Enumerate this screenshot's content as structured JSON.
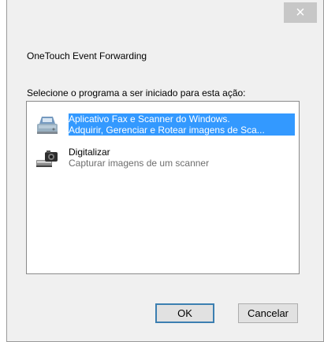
{
  "window": {
    "close_glyph": "×",
    "heading": "OneTouch Event Forwarding",
    "instruction": "Selecione o programa a ser iniciado para esta ação:"
  },
  "programs": [
    {
      "name": "Aplicativo Fax e Scanner do Windows.",
      "description": "Adquirir, Gerenciar e Rotear imagens de Sca...",
      "icon": "fax-scanner-icon",
      "selected": true
    },
    {
      "name": "Digitalizar",
      "description": "Capturar imagens de um scanner",
      "icon": "camera-scanner-icon",
      "selected": false
    }
  ],
  "buttons": {
    "ok": "OK",
    "cancel": "Cancelar"
  },
  "colors": {
    "selection": "#3399ff",
    "dialog_bg": "#f0f0f0",
    "close_bg": "#c7c7c7"
  }
}
